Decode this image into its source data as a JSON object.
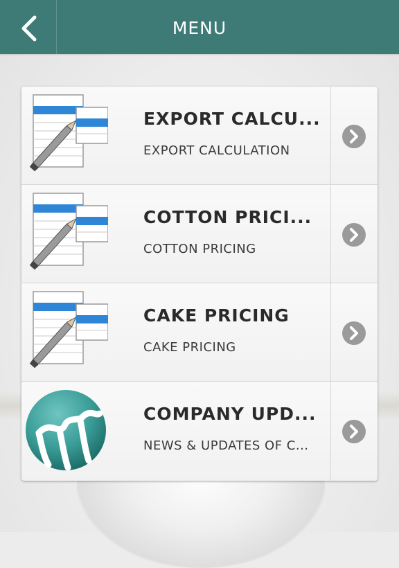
{
  "header": {
    "title": "MENU",
    "back_icon": "chevron-left-icon",
    "color": "#3e7b77"
  },
  "menu": {
    "items": [
      {
        "title": "EXPORT CALCU...",
        "subtitle": "EXPORT CALCULATION",
        "icon": "spreadsheet-pencil-icon"
      },
      {
        "title": "COTTON PRICI...",
        "subtitle": "COTTON PRICING",
        "icon": "spreadsheet-pencil-icon"
      },
      {
        "title": "CAKE PRICING",
        "subtitle": "CAKE PRICING",
        "icon": "spreadsheet-pencil-icon"
      },
      {
        "title": "COMPANY UPD...",
        "subtitle": "NEWS & UPDATES OF C...",
        "icon": "company-logo-icon"
      }
    ],
    "chevron_icon": "chevron-right-circle-icon"
  }
}
